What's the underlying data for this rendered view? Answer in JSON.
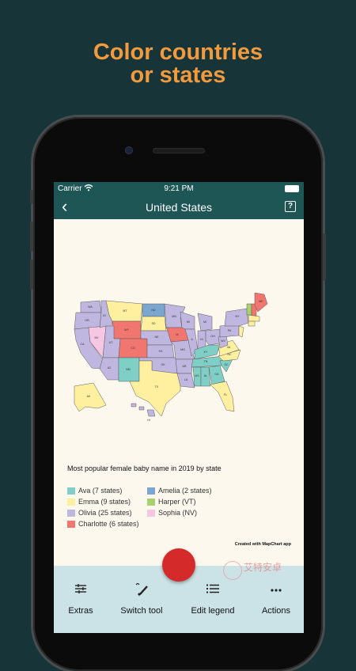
{
  "promo": {
    "headline_line1": "Color countries",
    "headline_line2": "or states"
  },
  "status_bar": {
    "carrier": "Carrier",
    "time": "9:21 PM"
  },
  "nav": {
    "title": "United States",
    "back_icon": "chevron-left-icon",
    "help_label": "?"
  },
  "map": {
    "labels": [
      "WA",
      "OR",
      "CA",
      "NV",
      "ID",
      "MT",
      "WY",
      "UT",
      "AZ",
      "CO",
      "NM",
      "ND",
      "SD",
      "NE",
      "KS",
      "OK",
      "TX",
      "MN",
      "IA",
      "MO",
      "AR",
      "LA",
      "WI",
      "IL",
      "IN",
      "MI",
      "OH",
      "KY",
      "TN",
      "MS",
      "AL",
      "GA",
      "FL",
      "SC",
      "NC",
      "VA",
      "WV",
      "PA",
      "NY",
      "ME",
      "AK",
      "HI"
    ],
    "colors": {
      "ava": "#7fcfc6",
      "emma": "#fff0a0",
      "olivia": "#bfb7df",
      "charlotte": "#f0766f",
      "amelia": "#7aa6d0",
      "harper": "#a8d070",
      "sophia": "#f6c6e2"
    }
  },
  "legend": {
    "title": "Most popular female baby name in 2019 by state",
    "items": [
      {
        "label": "Ava (7 states)",
        "color": "#7fcfc6"
      },
      {
        "label": "Emma (9 states)",
        "color": "#fff0a0"
      },
      {
        "label": "Olivia (25 states)",
        "color": "#bfb7df"
      },
      {
        "label": "Charlotte (6 states)",
        "color": "#f0766f"
      },
      {
        "label": "Amelia (2 states)",
        "color": "#7aa6d0"
      },
      {
        "label": "Harper (VT)",
        "color": "#a8d070"
      },
      {
        "label": "Sophia (NV)",
        "color": "#f6c6e2"
      }
    ]
  },
  "credit": "Created with MapChart app",
  "toolbar": {
    "extras": "Extras",
    "switch_tool": "Switch tool",
    "edit_legend": "Edit legend",
    "actions": "Actions"
  },
  "watermark": "艾特安卓"
}
